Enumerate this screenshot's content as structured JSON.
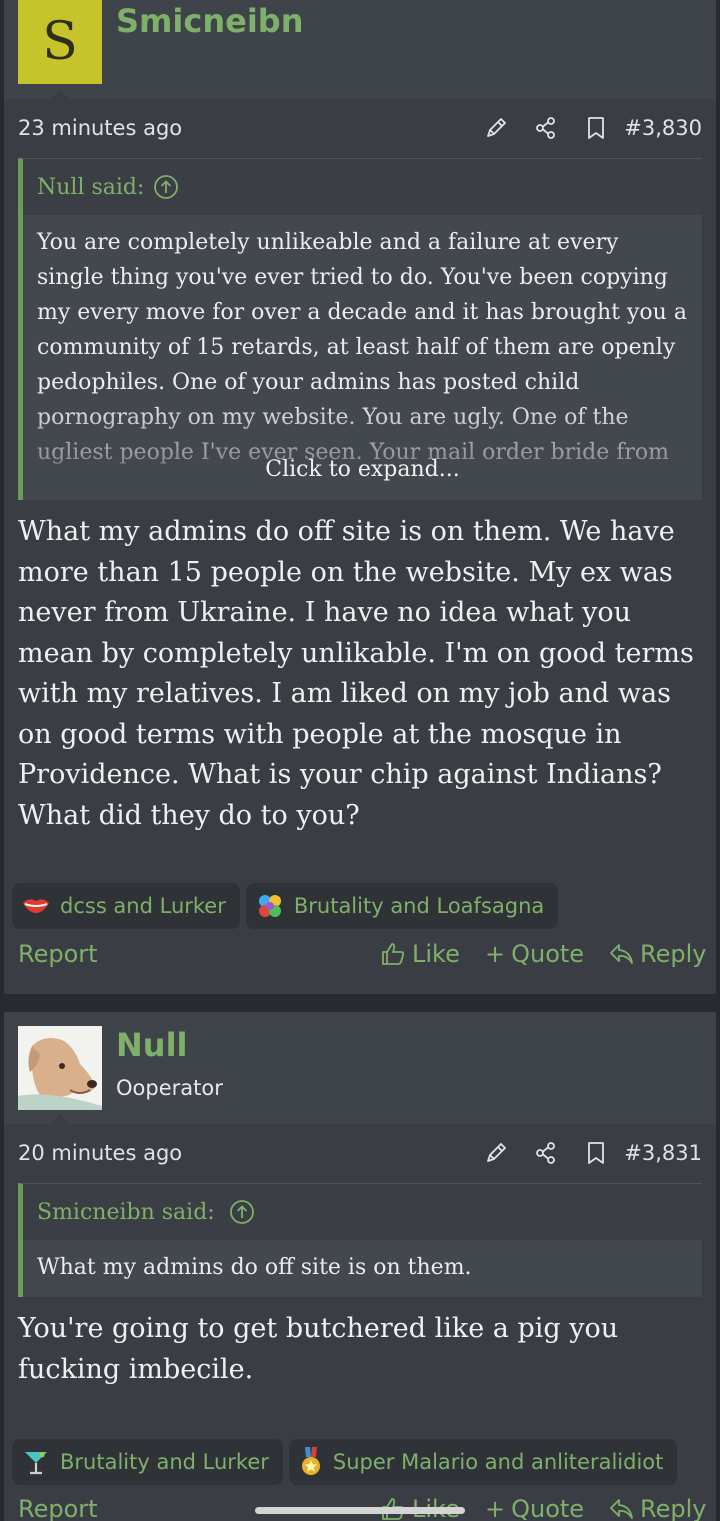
{
  "posts": [
    {
      "username": "Smicneibn",
      "avatar_letter": "S",
      "user_title": "",
      "time": "23 minutes ago",
      "post_number": "#3,830",
      "quote": {
        "attribution": "Null said:",
        "text": "You are completely unlikeable and a failure at every single thing you've ever tried to do. You've been copying my every move for over a decade and it has brought you a community of 15 retards, at least half of them are openly pedophiles. One of your admins has posted child pornography on my website. You are ugly. One of the ugliest people I've ever seen. Your mail order bride from",
        "expand_label": "Click to expand..."
      },
      "message": "What my admins do off site is on them. We have more than 15 people on the website. My ex was never from Ukraine. I have no idea what you mean by completely unlikable. I'm on good terms with my relatives. I am liked on my job and was on good terms with people at the mosque in Providence. What is your chip against Indians? What did they do to you?",
      "reactions": [
        {
          "icon": "lips-icon",
          "label": "dcss and Lurker"
        },
        {
          "icon": "puzzle-icon",
          "label": "Brutality and Loafsagna"
        }
      ],
      "actions": {
        "report": "Report",
        "like": "Like",
        "quote": "Quote",
        "reply": "Reply"
      }
    },
    {
      "username": "Null",
      "avatar_letter": "",
      "user_title": "Ooperator",
      "time": "20 minutes ago",
      "post_number": "#3,831",
      "quote": {
        "attribution": "Smicneibn said:",
        "text": "What my admins do off site is on them.",
        "expand_label": ""
      },
      "message": "You're going to get butchered like a pig you fucking imbecile.",
      "reactions": [
        {
          "icon": "cocktail-icon",
          "label": "Brutality and Lurker"
        },
        {
          "icon": "medal-icon",
          "label": "Super Malario and anliteralidiot"
        }
      ],
      "actions": {
        "report": "Report",
        "like": "Like",
        "quote": "Quote",
        "reply": "Reply"
      }
    }
  ],
  "colors": {
    "accent": "#7fb069",
    "avatar_bg": "#c7c42b",
    "post_bg": "#3a3e44",
    "page_bg": "#272b30"
  }
}
